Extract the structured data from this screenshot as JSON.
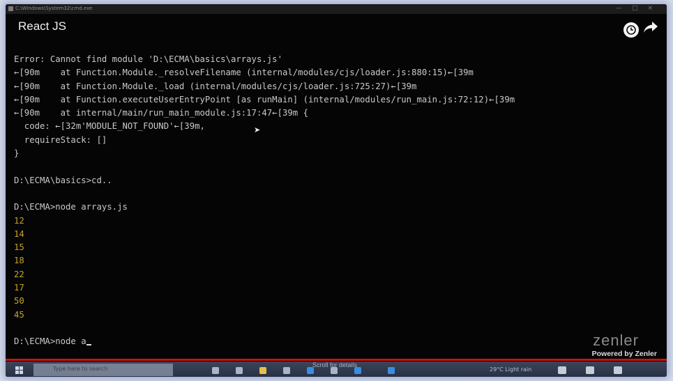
{
  "window": {
    "title_path": "C:\\Windows\\System32\\cmd.exe",
    "controls": [
      "—",
      "□",
      "×"
    ]
  },
  "video": {
    "title": "React JS",
    "watch_later_icon": "clock-icon",
    "share_icon": "share-arrow-icon",
    "progress": 1.0,
    "accent": "#cc1111"
  },
  "console": {
    "lines": [
      {
        "text": "Error: Cannot find module 'D:\\ECMA\\basics\\arrays.js'",
        "kind": "text"
      },
      {
        "text": "←[90m    at Function.Module._resolveFilename (internal/modules/cjs/loader.js:880:15)←[39m",
        "kind": "text"
      },
      {
        "text": "←[90m    at Function.Module._load (internal/modules/cjs/loader.js:725:27)←[39m",
        "kind": "text"
      },
      {
        "text": "←[90m    at Function.executeUserEntryPoint [as runMain] (internal/modules/run_main.js:72:12)←[39m",
        "kind": "text"
      },
      {
        "text": "←[90m    at internal/main/run_main_module.js:17:47←[39m {",
        "kind": "text"
      },
      {
        "text": "  code: ←[32m'MODULE_NOT_FOUND'←[39m,",
        "kind": "text"
      },
      {
        "text": "  requireStack: []",
        "kind": "text"
      },
      {
        "text": "}",
        "kind": "text"
      },
      {
        "text": "",
        "kind": "text"
      },
      {
        "text": "D:\\ECMA\\basics>cd..",
        "kind": "text"
      },
      {
        "text": "",
        "kind": "text"
      },
      {
        "text": "D:\\ECMA>node arrays.js",
        "kind": "text"
      },
      {
        "text": "12",
        "kind": "num"
      },
      {
        "text": "14",
        "kind": "num"
      },
      {
        "text": "15",
        "kind": "num"
      },
      {
        "text": "18",
        "kind": "num"
      },
      {
        "text": "22",
        "kind": "num"
      },
      {
        "text": "17",
        "kind": "num"
      },
      {
        "text": "50",
        "kind": "num"
      },
      {
        "text": "45",
        "kind": "num"
      },
      {
        "text": "",
        "kind": "text"
      },
      {
        "text": "D:\\ECMA>node a",
        "kind": "prompt"
      }
    ],
    "number_color": "#c6a52b"
  },
  "branding": {
    "logo": "zenler",
    "powered_by": "Powered by Zenler"
  },
  "taskbar": {
    "search_placeholder": "Type here to search",
    "scroll_hint": "Scroll for details",
    "weather": "29°C Light rain"
  }
}
